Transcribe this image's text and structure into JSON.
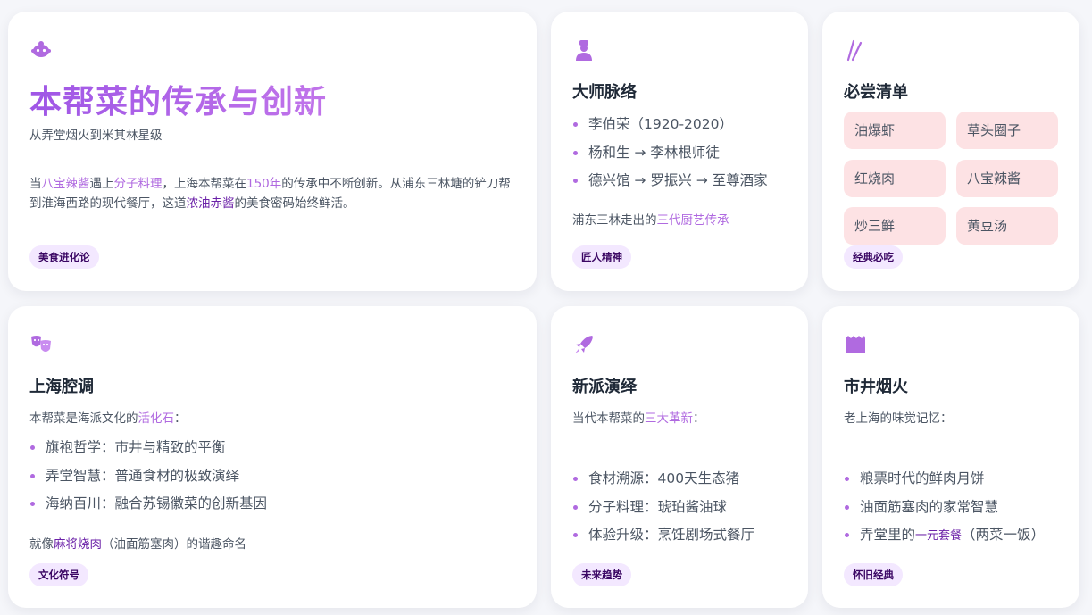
{
  "colors": {
    "accent": "#b06ae0",
    "accent_dark": "#6b21a8",
    "tag_bg": "#f3e8ff",
    "dish_bg": "#fde2e4"
  },
  "hero": {
    "icon": "mask-icon",
    "title": "本帮菜的传承与创新",
    "subtitle": "从弄堂烟火到米其林星级",
    "body": [
      {
        "text": "当",
        "style": "plain"
      },
      {
        "text": "八宝辣酱",
        "style": "hl"
      },
      {
        "text": "遇上",
        "style": "plain"
      },
      {
        "text": "分子料理",
        "style": "hl"
      },
      {
        "text": "，上海本帮菜在",
        "style": "plain"
      },
      {
        "text": "150年",
        "style": "hl"
      },
      {
        "text": "的传承中不断创新。从浦东三林塘的铲刀帮到淮海西路的现代餐厅，这道",
        "style": "plain"
      },
      {
        "text": "浓油赤酱",
        "style": "hl-dark"
      },
      {
        "text": "的美食密码始终鲜活。",
        "style": "plain"
      }
    ],
    "tag": "美食进化论"
  },
  "masters": {
    "icon": "chef-icon",
    "title": "大师脉络",
    "items": [
      "李伯荣（1920-2020）",
      "杨和生 → 李林根师徒",
      "德兴馆 → 罗振兴 → 至尊酒家"
    ],
    "note_prefix": "浦东三林走出的",
    "note_highlight": "三代厨艺传承",
    "tag": "匠人精神"
  },
  "must_try": {
    "icon": "chopsticks-icon",
    "title": "必尝清单",
    "dishes": [
      "油爆虾",
      "草头圈子",
      "红烧肉",
      "八宝辣酱",
      "炒三鲜",
      "黄豆汤"
    ],
    "tag": "经典必吃"
  },
  "dialect": {
    "icon": "theater-masks-icon",
    "title": "上海腔调",
    "intro_prefix": "本帮菜是海派文化的",
    "intro_highlight": "活化石",
    "intro_suffix": "：",
    "items": [
      "旗袍哲学：市井与精致的平衡",
      "弄堂智慧：普通食材的极致演绎",
      "海纳百川：融合苏锡徽菜的创新基因"
    ],
    "note_prefix": "就像",
    "note_highlight": "麻将烧肉",
    "note_suffix": "（油面筋塞肉）的谐趣命名",
    "tag": "文化符号"
  },
  "new_school": {
    "icon": "rocket-icon",
    "title": "新派演绎",
    "intro_prefix": "当代本帮菜的",
    "intro_highlight": "三大革新",
    "intro_suffix": "：",
    "items": [
      "食材溯源：400天生态猪",
      "分子料理：琥珀酱油球",
      "体验升级：烹饪剧场式餐厅"
    ],
    "tag": "未来趋势"
  },
  "street_life": {
    "icon": "storefront-icon",
    "title": "市井烟火",
    "intro": "老上海的味觉记忆：",
    "items": [
      {
        "prefix": "粮票时代的鲜肉月饼",
        "highlight": "",
        "suffix": ""
      },
      {
        "prefix": "油面筋塞肉的家常智慧",
        "highlight": "",
        "suffix": ""
      },
      {
        "prefix": "弄堂里的",
        "highlight": "一元套餐",
        "suffix": "（两菜一饭）"
      }
    ],
    "tag": "怀旧经典"
  }
}
